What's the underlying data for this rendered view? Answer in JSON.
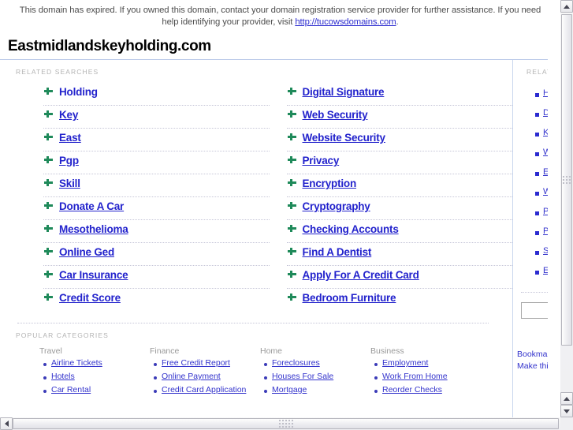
{
  "notice": {
    "text_before": "This domain has expired. If you owned this domain, contact your domain registration service provider for further assistance. If you need help identifying your provider, visit ",
    "link": "http://tucowsdomains.com",
    "text_after": "."
  },
  "domain": {
    "title": "Eastmidlandskeyholding.com"
  },
  "related": {
    "label": "RELATED SEARCHES",
    "left": [
      {
        "label": "Holding",
        "underline": false
      },
      {
        "label": "Key",
        "underline": true
      },
      {
        "label": "East",
        "underline": true
      },
      {
        "label": "Pgp",
        "underline": true
      },
      {
        "label": "Skill",
        "underline": true
      },
      {
        "label": "Donate A Car",
        "underline": true
      },
      {
        "label": "Mesothelioma",
        "underline": true
      },
      {
        "label": "Online Ged",
        "underline": true
      },
      {
        "label": "Car Insurance",
        "underline": true
      },
      {
        "label": "Credit Score",
        "underline": true
      }
    ],
    "right": [
      {
        "label": "Digital Signature",
        "underline": true
      },
      {
        "label": "Web Security",
        "underline": true
      },
      {
        "label": "Website Security",
        "underline": true
      },
      {
        "label": "Privacy",
        "underline": true
      },
      {
        "label": "Encryption",
        "underline": true
      },
      {
        "label": "Cryptography",
        "underline": true
      },
      {
        "label": "Checking Accounts",
        "underline": true
      },
      {
        "label": "Find A Dentist",
        "underline": true
      },
      {
        "label": "Apply For A Credit Card",
        "underline": true
      },
      {
        "label": "Bedroom Furniture",
        "underline": true
      }
    ]
  },
  "categories": {
    "label": "POPULAR CATEGORIES",
    "columns": [
      {
        "heading": "Travel",
        "items": [
          "Airline Tickets",
          "Hotels",
          "Car Rental"
        ]
      },
      {
        "heading": "Finance",
        "items": [
          "Free Credit Report",
          "Online Payment",
          "Credit Card Application"
        ]
      },
      {
        "heading": "Home",
        "items": [
          "Foreclosures",
          "Houses For Sale",
          "Mortgage"
        ]
      },
      {
        "heading": "Business",
        "items": [
          "Employment",
          "Work From Home",
          "Reorder Checks"
        ]
      }
    ]
  },
  "sidebar": {
    "label": "RELATED",
    "items": [
      "Ho",
      "Di",
      "Ke",
      "We",
      "Ea",
      "We",
      "Pg",
      "Pri",
      "Sk",
      "En"
    ],
    "search_value": "",
    "footer_line1": "Bookmark",
    "footer_line2": "Make thi"
  },
  "colors": {
    "link": "#2222cc",
    "bullet_green": "#1f8a5a",
    "bullet_blue": "#2b2bd0",
    "label_gray": "#b3b3b3",
    "rule_blue": "#b9c8e8"
  }
}
